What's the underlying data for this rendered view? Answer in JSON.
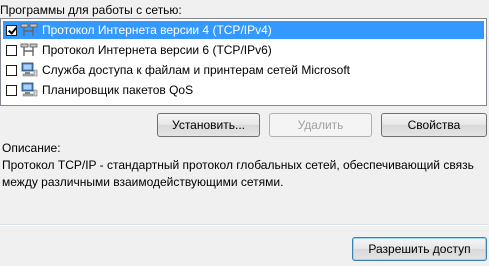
{
  "components": {
    "label": "Программы для работы с сетью:",
    "items": [
      {
        "label": "Протокол Интернета версии 4 (TCP/IPv4)",
        "checked": true,
        "selected": true,
        "icon": "network-protocol-icon"
      },
      {
        "label": "Протокол Интернета версии 6 (TCP/IPv6)",
        "checked": false,
        "selected": false,
        "icon": "network-protocol-icon"
      },
      {
        "label": "Служба доступа к файлам и принтерам сетей Microsoft",
        "checked": false,
        "selected": false,
        "icon": "network-service-icon"
      },
      {
        "label": "Планировщик пакетов QoS",
        "checked": false,
        "selected": false,
        "icon": "network-service-icon"
      }
    ]
  },
  "buttons": {
    "install": "Установить...",
    "remove": "Удалить",
    "properties": "Свойства",
    "allow": "Разрешить доступ"
  },
  "description": {
    "label": "Описание:",
    "text": "Протокол TCP/IP - стандартный протокол глобальных сетей, обеспечивающий связь между различными взаимодействующими сетями."
  },
  "colors": {
    "selection": "#3399ff",
    "window_bg": "#f0f0f0"
  }
}
